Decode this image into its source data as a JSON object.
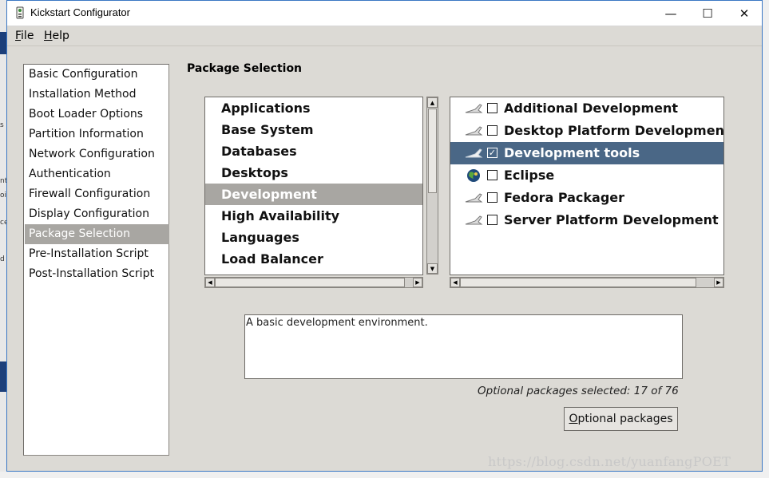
{
  "window": {
    "title": "Kickstart Configurator",
    "controls": {
      "minimize": "—",
      "maximize": "☐",
      "close": "✕"
    }
  },
  "menu": {
    "items": [
      {
        "label_rest": "ile",
        "mnemonic": "F"
      },
      {
        "label_rest": "elp",
        "mnemonic": "H"
      }
    ]
  },
  "nav": {
    "items": [
      "Basic Configuration",
      "Installation Method",
      "Boot Loader Options",
      "Partition Information",
      "Network Configuration",
      "Authentication",
      "Firewall Configuration",
      "Display Configuration",
      "Package Selection",
      "Pre-Installation Script",
      "Post-Installation Script"
    ],
    "selected": "Package Selection"
  },
  "section_title": "Package Selection",
  "groups": {
    "items": [
      "Applications",
      "Base System",
      "Databases",
      "Desktops",
      "Development",
      "High Availability",
      "Languages",
      "Load Balancer"
    ],
    "selected": "Development"
  },
  "packages": {
    "items": [
      {
        "name": "Additional Development",
        "checked": false,
        "icon": "gear-icon"
      },
      {
        "name": "Desktop Platform Development",
        "checked": false,
        "icon": "gear-icon"
      },
      {
        "name": "Development tools",
        "checked": true,
        "icon": "gear-icon"
      },
      {
        "name": "Eclipse",
        "checked": false,
        "icon": "eclipse-globe-icon"
      },
      {
        "name": "Fedora Packager",
        "checked": false,
        "icon": "gear-icon"
      },
      {
        "name": "Server Platform Development",
        "checked": false,
        "icon": "gear-icon"
      }
    ],
    "selected": "Development tools"
  },
  "description": "A basic development environment.",
  "optional_status": "Optional packages selected: 17 of 76",
  "optional_button": {
    "mnemonic": "O",
    "label_rest": "ptional packages"
  },
  "watermark": "https://blog.csdn.net/yuanfangPOET",
  "background": {
    "fragments": [
      "s",
      "nt",
      "oi",
      "ce",
      "d"
    ]
  },
  "colors": {
    "window_bg": "#dcdad5",
    "selection_gray": "#a8a6a2",
    "selection_blue": "#4a6786",
    "border_blue": "#3b78c4"
  }
}
